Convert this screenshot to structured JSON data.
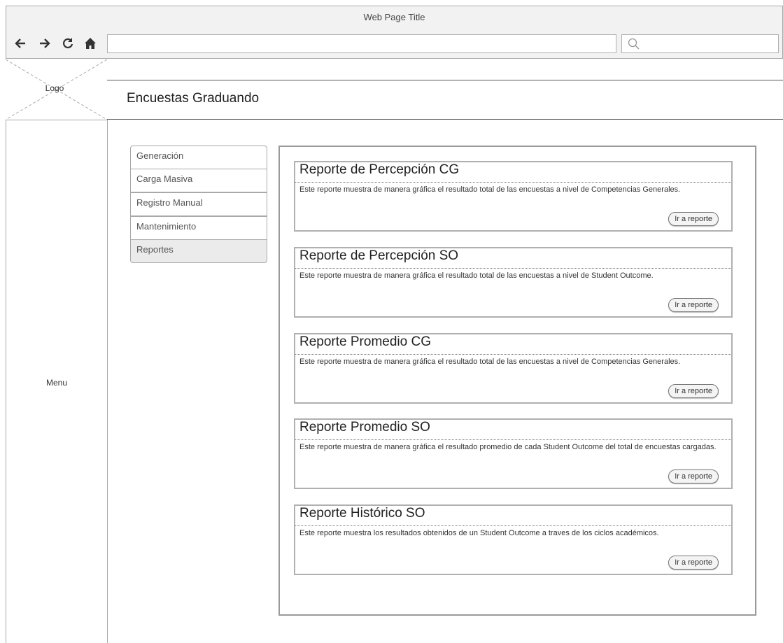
{
  "browser": {
    "window_title": "Web Page Title",
    "nav_icons": [
      "back-arrow-icon",
      "forward-arrow-icon",
      "reload-icon",
      "home-icon"
    ],
    "address_value": "",
    "search_value": ""
  },
  "logo": {
    "label": "Logo"
  },
  "sidebar": {
    "label": "Menu"
  },
  "header": {
    "title": "Encuestas Graduando"
  },
  "submenu": {
    "items": [
      {
        "label": "Generación"
      },
      {
        "label": "Carga Masiva"
      },
      {
        "label": "Registro Manual"
      },
      {
        "label": "Mantenimiento"
      },
      {
        "label": "Reportes",
        "active": true
      }
    ]
  },
  "reports": [
    {
      "title": "Reporte de Percepción CG",
      "description": "Este reporte muestra de manera gráfica el resultado total de las encuestas a nivel de Competencias Generales.",
      "button": "Ir a reporte"
    },
    {
      "title": "Reporte de Percepción SO",
      "description": "Este reporte muestra de manera gráfica el resultado total de las encuestas a nivel de Student Outcome.",
      "button": "Ir a reporte"
    },
    {
      "title": "Reporte Promedio CG",
      "description": "Este reporte muestra de manera gráfica el resultado total de las encuestas a nivel de Competencias Generales.",
      "button": "Ir a reporte"
    },
    {
      "title": "Reporte Promedio SO",
      "description": "Este reporte muestra de manera gráfica el resultado promedio de cada Student Outcome del total de encuestas cargadas.",
      "button": "Ir a reporte"
    },
    {
      "title": "Reporte Histórico SO",
      "description": "Este reporte muestra los resultados obtenidos de un Student Outcome a traves de los ciclos académicos.",
      "button": "Ir a reporte"
    }
  ]
}
